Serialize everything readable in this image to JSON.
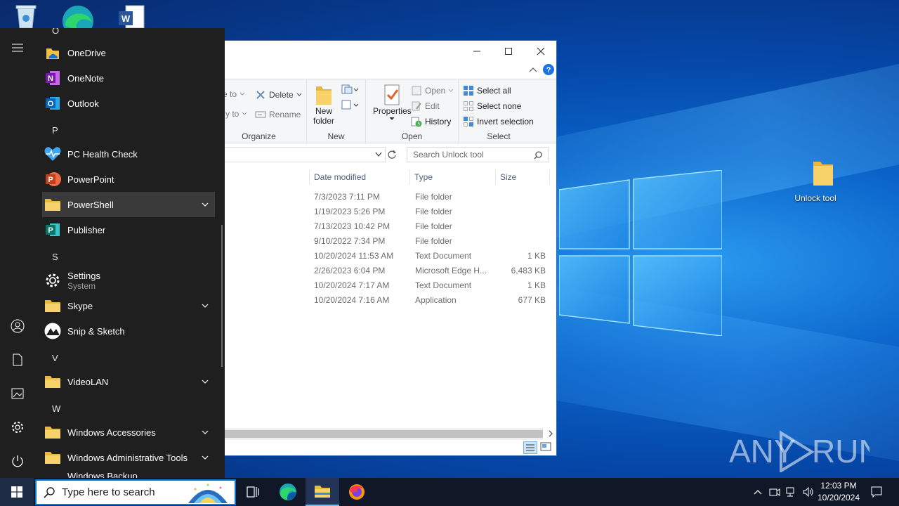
{
  "desktop": {
    "icons": [
      {
        "label": "Unlock tool",
        "icon": "folder-icon"
      }
    ],
    "top_icons": [
      "recycle-bin-icon",
      "edge-icon",
      "word-doc-icon"
    ],
    "watermark": "ANY RUN"
  },
  "explorer": {
    "search_placeholder": "Search Unlock tool",
    "ribbon": {
      "organize": {
        "label": "Organize",
        "move_to": "e to",
        "copy_to": "y to",
        "delete": "Delete",
        "rename": "Rename"
      },
      "new": {
        "label": "New",
        "new_folder_line1": "New",
        "new_folder_line2": "folder"
      },
      "open": {
        "label": "Open",
        "properties": "Properties",
        "open": "Open",
        "edit": "Edit",
        "history": "History"
      },
      "select": {
        "label": "Select",
        "select_all": "Select all",
        "select_none": "Select none",
        "invert": "Invert selection"
      }
    },
    "columns": {
      "date": "Date modified",
      "type": "Type",
      "size": "Size"
    },
    "files": [
      {
        "date": "7/3/2023 7:11 PM",
        "type": "File folder",
        "size": ""
      },
      {
        "date": "1/19/2023 5:26 PM",
        "type": "File folder",
        "size": ""
      },
      {
        "date": "7/13/2023 10:42 PM",
        "type": "File folder",
        "size": ""
      },
      {
        "date": "9/10/2022 7:34 PM",
        "type": "File folder",
        "size": ""
      },
      {
        "date": "10/20/2024 11:53 AM",
        "type": "Text Document",
        "size": "1 KB"
      },
      {
        "date": "2/26/2023 6:04 PM",
        "type": "Microsoft Edge H...",
        "size": "6,483 KB"
      },
      {
        "date": "10/20/2024 7:17 AM",
        "type": "Text Document",
        "size": "1 KB"
      },
      {
        "date": "10/20/2024 7:16 AM",
        "type": "Application",
        "size": "677 KB"
      }
    ]
  },
  "start_menu": {
    "top_letter": "O",
    "apps": [
      {
        "label": "OneDrive",
        "icon": "onedrive-icon"
      },
      {
        "label": "OneNote",
        "icon": "onenote-icon"
      },
      {
        "label": "Outlook",
        "icon": "outlook-icon"
      },
      {
        "letter": "P"
      },
      {
        "label": "PC Health Check",
        "icon": "health-check-icon"
      },
      {
        "label": "PowerPoint",
        "icon": "powerpoint-icon"
      },
      {
        "label": "PowerShell",
        "icon": "folder-icon",
        "expand": true,
        "selected": true
      },
      {
        "label": "Publisher",
        "icon": "publisher-icon"
      },
      {
        "letter": "S"
      },
      {
        "label": "Settings",
        "sub": "System",
        "icon": "settings-icon"
      },
      {
        "label": "Skype",
        "icon": "folder-icon",
        "expand": true
      },
      {
        "label": "Snip & Sketch",
        "icon": "snip-sketch-icon"
      },
      {
        "letter": "V"
      },
      {
        "label": "VideoLAN",
        "icon": "folder-icon",
        "expand": true
      },
      {
        "letter": "W"
      },
      {
        "label": "Windows Accessories",
        "icon": "folder-icon",
        "expand": true
      },
      {
        "label": "Windows Administrative Tools",
        "icon": "folder-icon",
        "expand": true
      },
      {
        "label": "Windows Backup",
        "icon": "backup-icon"
      }
    ]
  },
  "taskbar": {
    "search_placeholder": "Type here to search",
    "time": "12:03 PM",
    "date": "10/20/2024"
  }
}
